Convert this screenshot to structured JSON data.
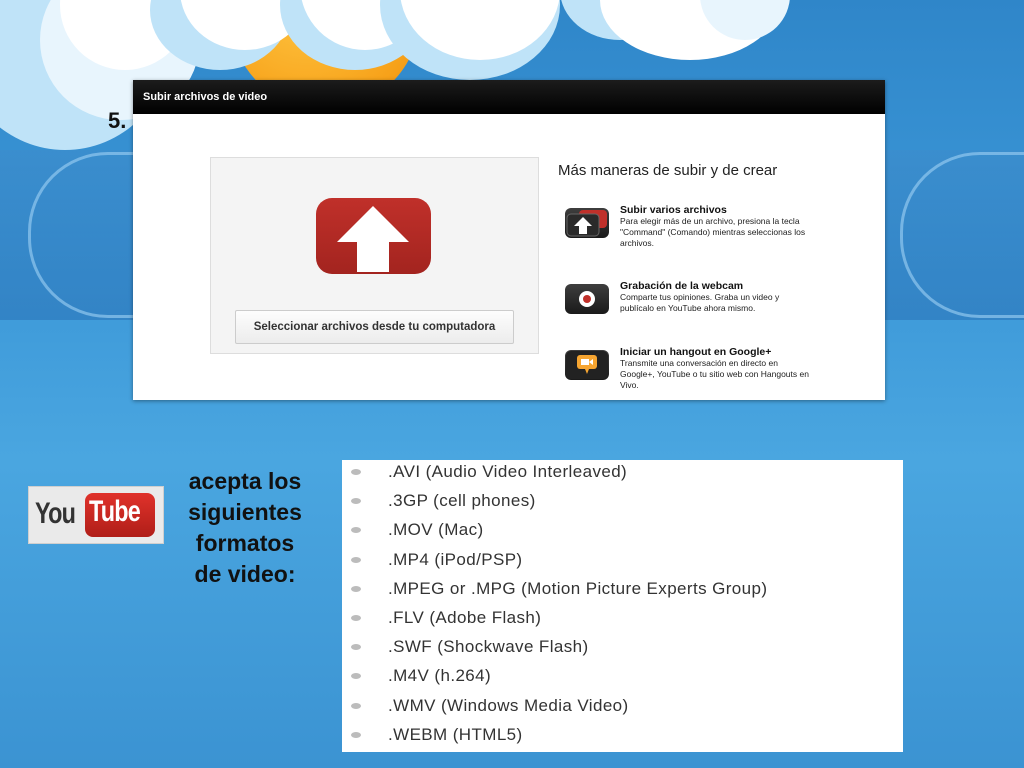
{
  "slide_number": "5.",
  "upload_dialog": {
    "header": "Subir archivos de video",
    "select_button": "Seleccionar archivos desde tu computadora",
    "more_title": "Más maneras de subir y de crear",
    "options": [
      {
        "title": "Subir varios archivos",
        "desc": "Para elegir más de un archivo, presiona la tecla \"Command\" (Comando) mientras seleccionas los archivos.",
        "icon": "multi-upload-icon"
      },
      {
        "title": "Grabación de la webcam",
        "desc": "Comparte tus opiniones. Graba un video y publícalo en YouTube ahora mismo.",
        "icon": "webcam-icon"
      },
      {
        "title": "Iniciar un hangout en Google+",
        "desc": "Transmite una conversación en directo en Google+, YouTube o tu sitio web con Hangouts en Vivo.",
        "icon": "hangout-icon"
      }
    ]
  },
  "logo": {
    "you": "You",
    "tube": "Tube"
  },
  "caption_lines": [
    "acepta los",
    "siguientes",
    "formatos",
    "de video:"
  ],
  "formats": [
    ".AVI (Audio Video Interleaved)",
    ".3GP (cell phones)",
    ".MOV (Mac)",
    ".MP4 (iPod/PSP)",
    ".MPEG or .MPG (Motion Picture Experts Group)",
    ".FLV (Adobe Flash)",
    ".SWF (Shockwave Flash)",
    ".M4V (h.264)",
    ".WMV (Windows Media Video)",
    ".WEBM (HTML5)"
  ],
  "colors": {
    "background": "#3a94d4",
    "youtube_red": "#c0302a",
    "hangout_orange": "#f6a531"
  }
}
